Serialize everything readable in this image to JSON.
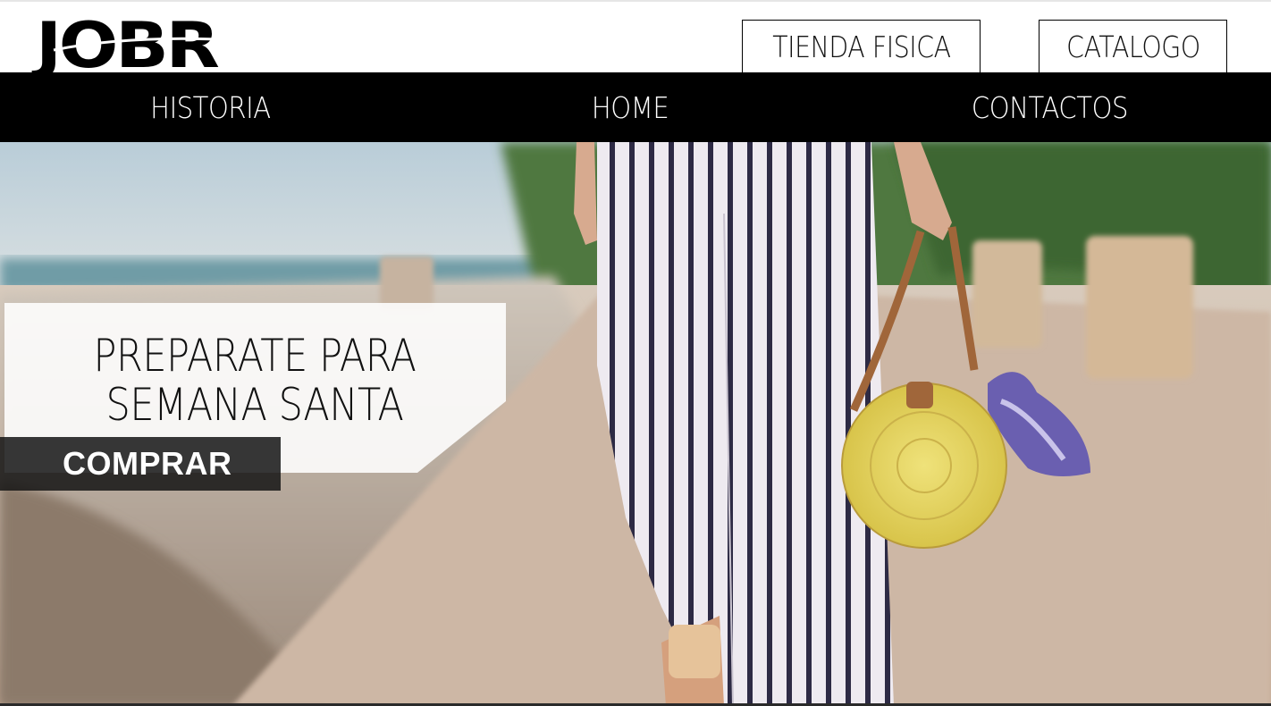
{
  "brand": {
    "logo_text": "JOBR"
  },
  "header": {
    "buttons": [
      {
        "label": "TIENDA FISICA"
      },
      {
        "label": "CATALOGO"
      }
    ]
  },
  "nav": {
    "items": [
      {
        "label": "HISTORIA"
      },
      {
        "label": "HOME"
      },
      {
        "label": "CONTACTOS"
      }
    ]
  },
  "hero": {
    "promo_line_1": "PREPARATE PARA",
    "promo_line_2": "SEMANA SANTA",
    "cta_label": "COMPRAR"
  },
  "colors": {
    "nav_background": "#000000",
    "page_background": "#ffffff",
    "cta_background": "#1e1e1e",
    "bag_yellow": "#e8dc6a",
    "strap_brown": "#a0663a"
  }
}
